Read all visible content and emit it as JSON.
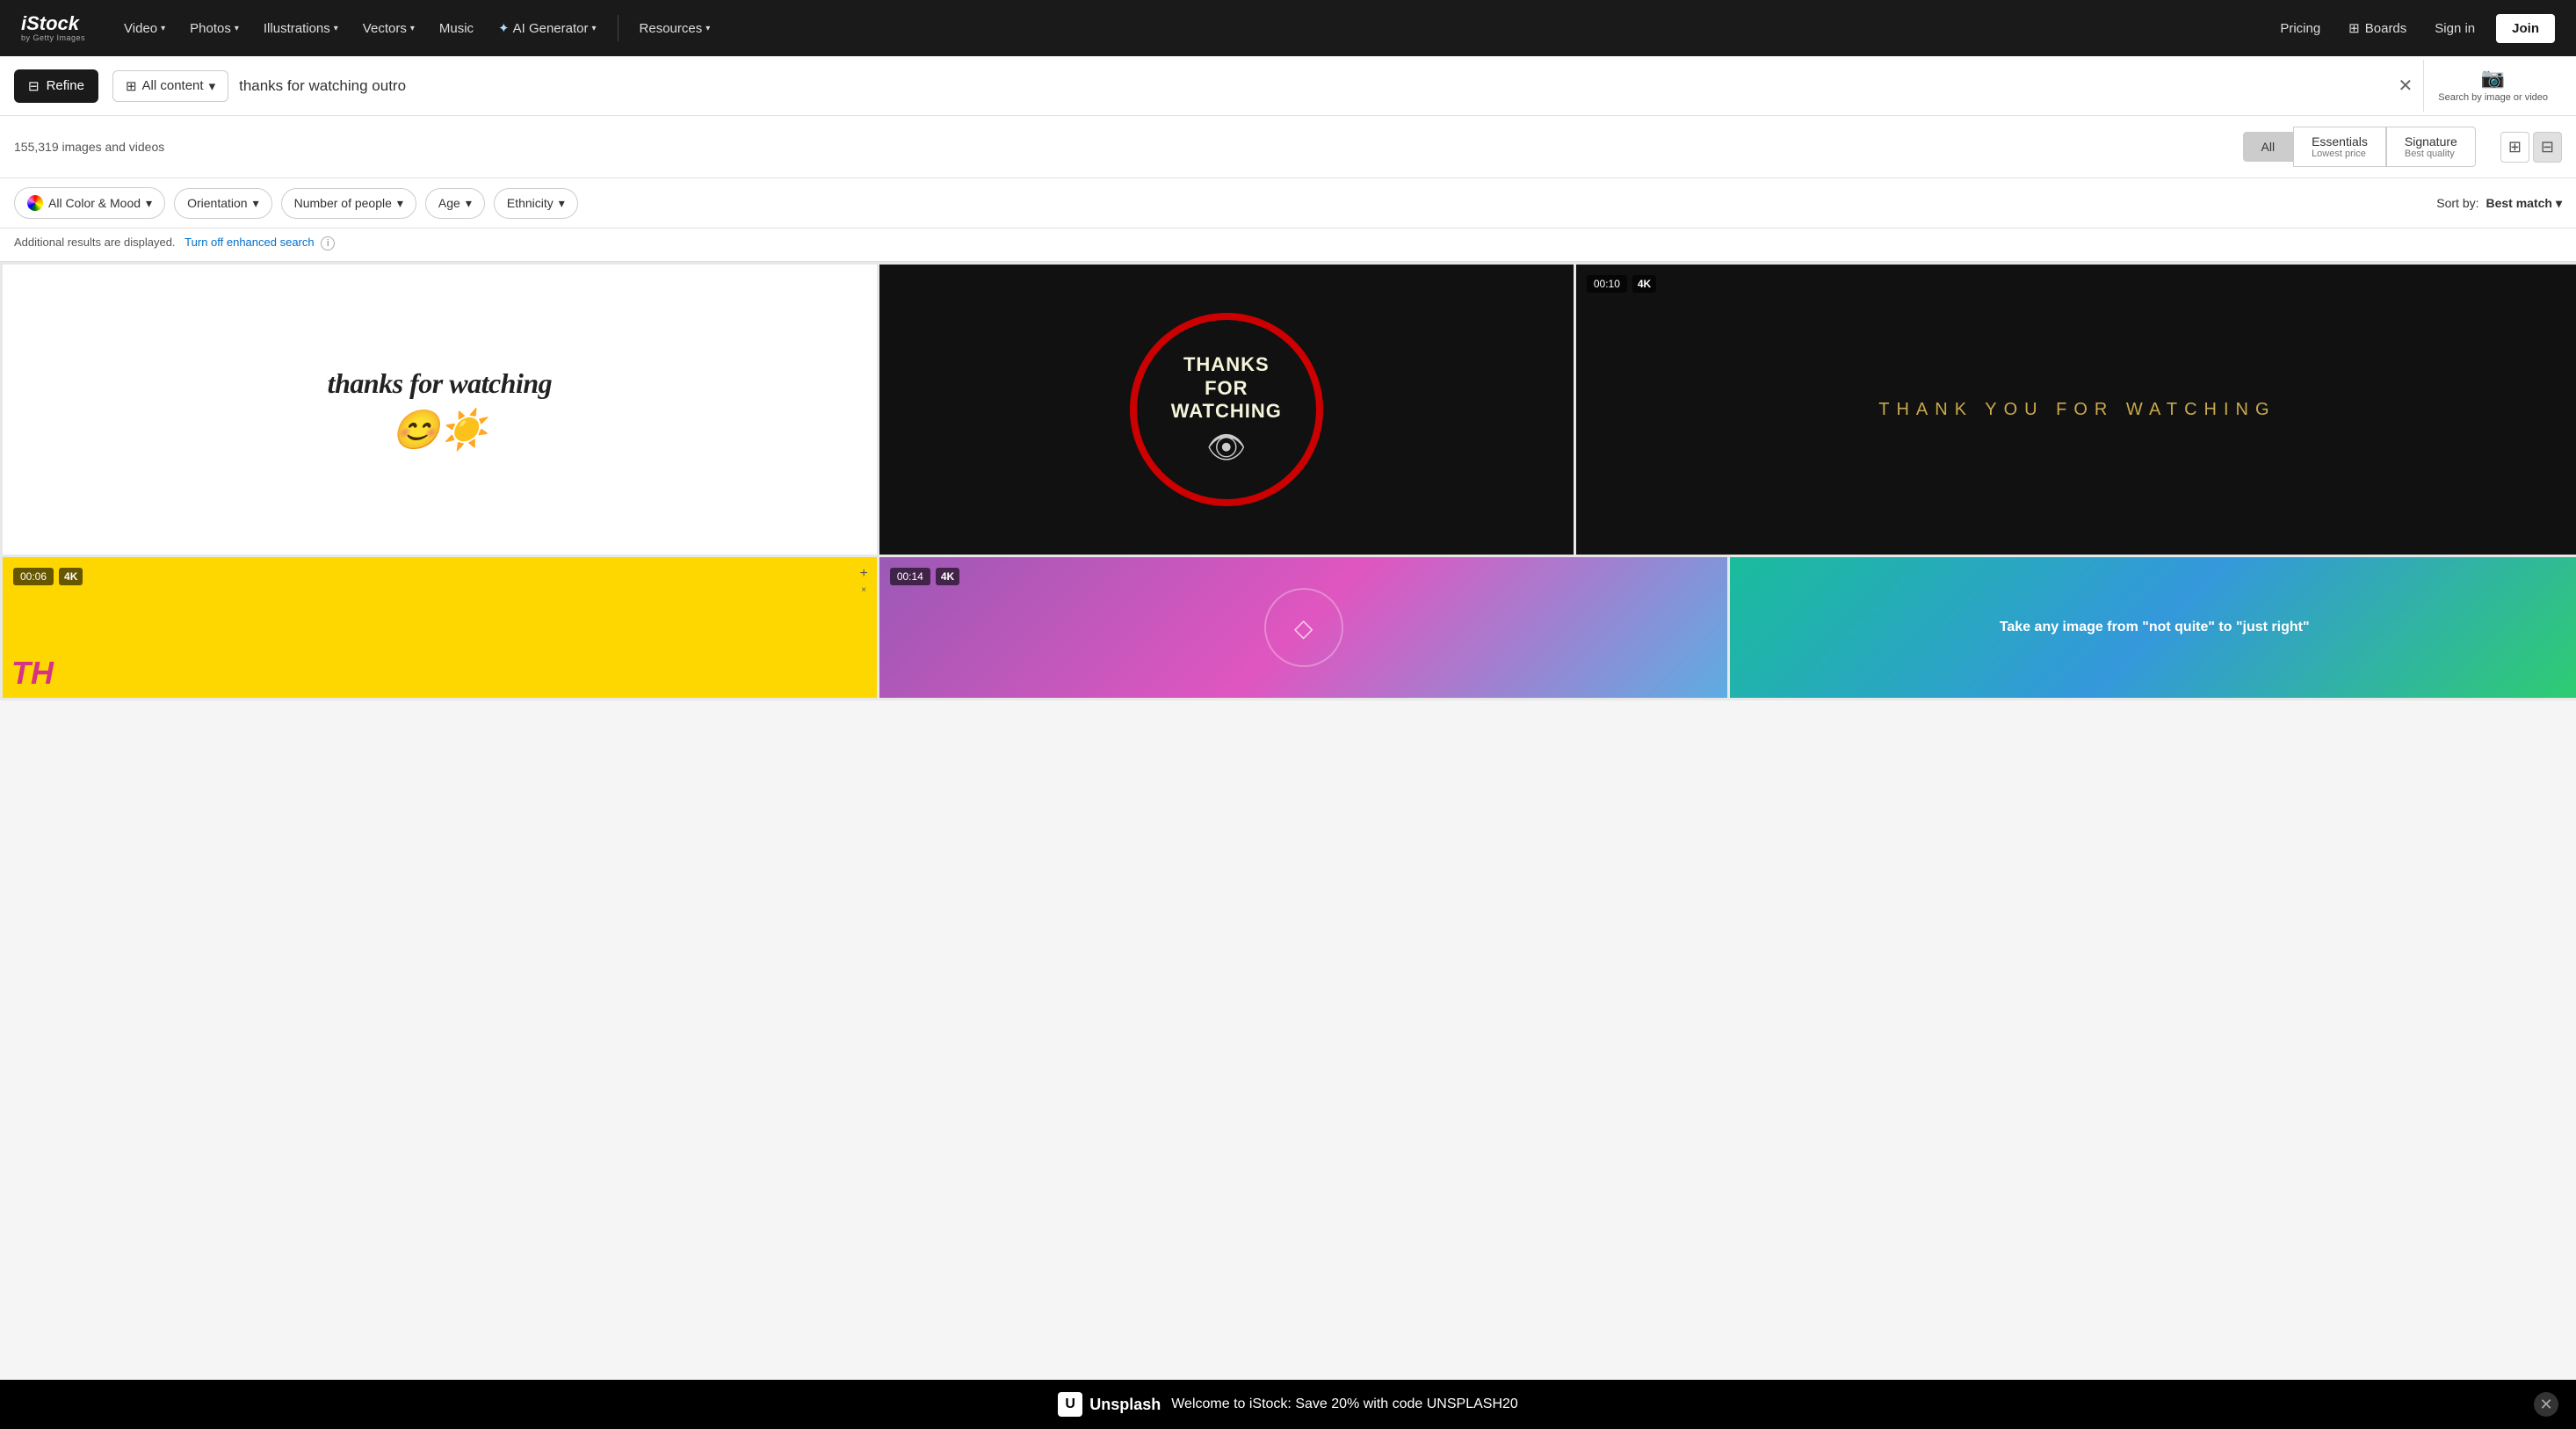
{
  "nav": {
    "logo": "iStock",
    "logo_sub": "by Getty Images",
    "items": [
      {
        "label": "Video",
        "has_chevron": true
      },
      {
        "label": "Photos",
        "has_chevron": true
      },
      {
        "label": "Illustrations",
        "has_chevron": true
      },
      {
        "label": "Vectors",
        "has_chevron": true
      },
      {
        "label": "Music",
        "has_chevron": false
      },
      {
        "label": "AI Generator",
        "has_chevron": true
      },
      {
        "label": "Resources",
        "has_chevron": true
      }
    ],
    "right_items": [
      {
        "label": "Pricing",
        "id": "pricing"
      },
      {
        "label": "Boards",
        "id": "boards",
        "has_icon": true
      },
      {
        "label": "Sign in",
        "id": "signin"
      },
      {
        "label": "Join",
        "id": "join"
      }
    ]
  },
  "search": {
    "refine_label": "Refine",
    "content_filter": "All content",
    "query": "thanks for watching outro",
    "clear_title": "Clear search",
    "search_by_image_label": "Search by image or video"
  },
  "results": {
    "count": "155,319 images and videos",
    "tabs": [
      {
        "label": "All",
        "sub": "",
        "active": true
      },
      {
        "label": "Essentials",
        "sub": "Lowest price"
      },
      {
        "label": "Signature",
        "sub": "Best quality"
      }
    ]
  },
  "filters": {
    "color_mood": "All Color & Mood",
    "orientation": "Orientation",
    "number_of_people": "Number of people",
    "age": "Age",
    "ethnicity": "Ethnicity",
    "sort_label": "Sort by:",
    "sort_value": "Best match"
  },
  "enhanced_search": {
    "note": "Additional results are displayed.",
    "link": "Turn off enhanced search"
  },
  "grid_items": [
    {
      "id": "item1",
      "type": "illustration",
      "bg": "white",
      "text": "thanks for watching",
      "has_emoji": true
    },
    {
      "id": "item2",
      "type": "illustration",
      "bg": "black_red",
      "text": "THANKS FOR WATCHING"
    },
    {
      "id": "item3",
      "type": "video",
      "bg": "black",
      "duration": "00:10",
      "quality": "4K",
      "text": "THANK YOU FOR WATCHING"
    },
    {
      "id": "item4",
      "type": "video",
      "bg": "yellow",
      "duration": "00:06",
      "quality": "4K",
      "text": "TH"
    },
    {
      "id": "item5",
      "type": "video",
      "bg": "purple_gradient",
      "duration": "00:14",
      "quality": "4K"
    },
    {
      "id": "item6",
      "type": "promotional",
      "bg": "teal_gradient",
      "text": "Take any image from \"not quite\" to \"just right\""
    }
  ],
  "banner": {
    "logo": "Unsplash",
    "message": "Welcome to iStock: Save 20% with code UNSPLASH20"
  }
}
